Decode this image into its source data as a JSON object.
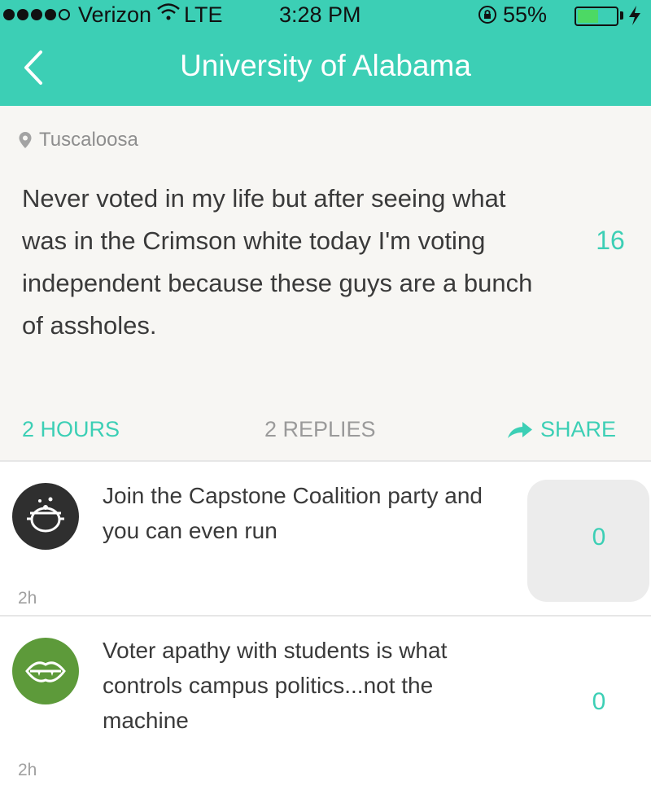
{
  "status_bar": {
    "carrier": "Verizon",
    "network": "LTE",
    "time": "3:28 PM",
    "battery": "55%",
    "battery_level": 0.55,
    "signal_bars_filled": 4,
    "signal_bars_total": 5
  },
  "nav": {
    "title": "University of Alabama",
    "back_icon": "chevron-left-icon"
  },
  "post": {
    "location": "Tuscaloosa",
    "text": "Never voted in my life but after seeing what was in the Crimson white today I'm voting independent because these guys are a bunch of assholes.",
    "votes": "16",
    "age": "2 HOURS",
    "replies": "2 REPLIES",
    "share": "SHARE"
  },
  "replies": [
    {
      "avatar_icon": "pot-icon",
      "avatar_color": "#2f2f2f",
      "text": "Join the Capstone Coalition party and you can even run",
      "votes": "0",
      "age": "2h"
    },
    {
      "avatar_icon": "vampire-mouth-icon",
      "avatar_color": "#5d9a3a",
      "text": "Voter apathy with students is what controls campus politics...not the machine",
      "votes": "0",
      "age": "2h"
    }
  ],
  "colors": {
    "accent": "#3ccfb5",
    "post_background": "#f7f6f3"
  }
}
